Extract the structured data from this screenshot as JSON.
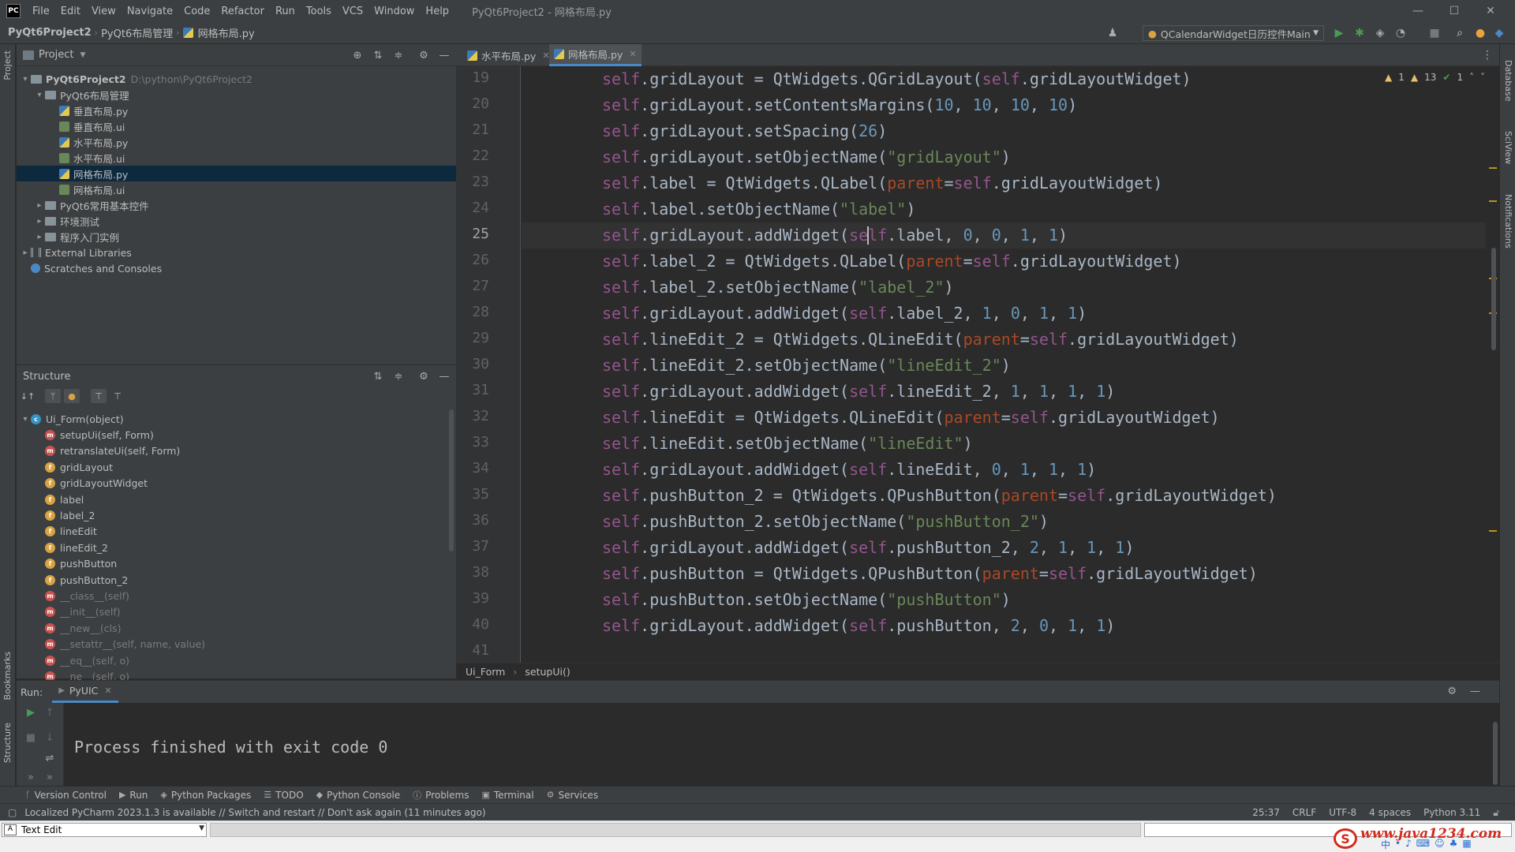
{
  "menubar": {
    "app_logo": "PC",
    "items": [
      "File",
      "Edit",
      "View",
      "Navigate",
      "Code",
      "Refactor",
      "Run",
      "Tools",
      "VCS",
      "Window",
      "Help"
    ],
    "window_title": "PyQt6Project2 - 网格布局.py"
  },
  "navbar": {
    "crumbs": [
      "PyQt6Project2",
      "PyQt6布局管理",
      "网格布局.py"
    ],
    "run_config": "QCalendarWidget日历控件Main"
  },
  "project": {
    "header": "Project",
    "tree": [
      {
        "label": "PyQt6Project2",
        "extra": "D:\\python\\PyQt6Project2",
        "indent": 0,
        "kind": "folder",
        "arrow": "▾",
        "bold": true
      },
      {
        "label": "PyQt6布局管理",
        "indent": 1,
        "kind": "folder",
        "arrow": "▾"
      },
      {
        "label": "垂直布局.py",
        "indent": 2,
        "kind": "py"
      },
      {
        "label": "垂直布局.ui",
        "indent": 2,
        "kind": "ui"
      },
      {
        "label": "水平布局.py",
        "indent": 2,
        "kind": "py"
      },
      {
        "label": "水平布局.ui",
        "indent": 2,
        "kind": "ui"
      },
      {
        "label": "网格布局.py",
        "indent": 2,
        "kind": "py",
        "selected": true
      },
      {
        "label": "网格布局.ui",
        "indent": 2,
        "kind": "ui"
      },
      {
        "label": "PyQt6常用基本控件",
        "indent": 1,
        "kind": "folder",
        "arrow": "▸"
      },
      {
        "label": "环境测试",
        "indent": 1,
        "kind": "folder",
        "arrow": "▸"
      },
      {
        "label": "程序入门实例",
        "indent": 1,
        "kind": "folder",
        "arrow": "▸"
      },
      {
        "label": "External Libraries",
        "indent": 0,
        "kind": "lib",
        "arrow": "▸"
      },
      {
        "label": "Scratches and Consoles",
        "indent": 0,
        "kind": "scratch"
      }
    ]
  },
  "structure": {
    "header": "Structure",
    "items": [
      {
        "label": "Ui_Form(object)",
        "badge": "c",
        "indent": 0,
        "arrow": "▾"
      },
      {
        "label": "setupUi(self, Form)",
        "badge": "m",
        "indent": 1
      },
      {
        "label": "retranslateUi(self, Form)",
        "badge": "m",
        "indent": 1
      },
      {
        "label": "gridLayout",
        "badge": "f",
        "indent": 1
      },
      {
        "label": "gridLayoutWidget",
        "badge": "f",
        "indent": 1
      },
      {
        "label": "label",
        "badge": "f",
        "indent": 1
      },
      {
        "label": "label_2",
        "badge": "f",
        "indent": 1
      },
      {
        "label": "lineEdit",
        "badge": "f",
        "indent": 1
      },
      {
        "label": "lineEdit_2",
        "badge": "f",
        "indent": 1
      },
      {
        "label": "pushButton",
        "badge": "f",
        "indent": 1
      },
      {
        "label": "pushButton_2",
        "badge": "f",
        "indent": 1
      },
      {
        "label": "__class__(self)",
        "badge": "m",
        "indent": 1,
        "grey": true
      },
      {
        "label": "__init__(self)",
        "badge": "m",
        "indent": 1,
        "grey": true
      },
      {
        "label": "__new__(cls)",
        "badge": "m",
        "indent": 1,
        "grey": true
      },
      {
        "label": "__setattr__(self, name, value)",
        "badge": "m",
        "indent": 1,
        "grey": true
      },
      {
        "label": "__eq__(self, o)",
        "badge": "m",
        "indent": 1,
        "grey": true
      },
      {
        "label": "__ne__(self, o)",
        "badge": "m",
        "indent": 1,
        "grey": true
      }
    ]
  },
  "editor": {
    "tabs": [
      {
        "label": "水平布局.py",
        "active": false
      },
      {
        "label": "网格布局.py",
        "active": true
      }
    ],
    "inspections": {
      "warn1": "1",
      "warn2": "13",
      "ok": "1"
    },
    "current_line": 25,
    "lines": [
      {
        "n": 19,
        "code": "self.gridLayout = QtWidgets.QGridLayout(self.gridLayoutWidget)"
      },
      {
        "n": 20,
        "code": "self.gridLayout.setContentsMargins(10, 10, 10, 10)"
      },
      {
        "n": 21,
        "code": "self.gridLayout.setSpacing(26)"
      },
      {
        "n": 22,
        "code": "self.gridLayout.setObjectName(\"gridLayout\")"
      },
      {
        "n": 23,
        "code": "self.label = QtWidgets.QLabel(parent=self.gridLayoutWidget)"
      },
      {
        "n": 24,
        "code": "self.label.setObjectName(\"label\")"
      },
      {
        "n": 25,
        "code": "self.gridLayout.addWidget(self.label, 0, 0, 1, 1)"
      },
      {
        "n": 26,
        "code": "self.label_2 = QtWidgets.QLabel(parent=self.gridLayoutWidget)"
      },
      {
        "n": 27,
        "code": "self.label_2.setObjectName(\"label_2\")"
      },
      {
        "n": 28,
        "code": "self.gridLayout.addWidget(self.label_2, 1, 0, 1, 1)"
      },
      {
        "n": 29,
        "code": "self.lineEdit_2 = QtWidgets.QLineEdit(parent=self.gridLayoutWidget)"
      },
      {
        "n": 30,
        "code": "self.lineEdit_2.setObjectName(\"lineEdit_2\")"
      },
      {
        "n": 31,
        "code": "self.gridLayout.addWidget(self.lineEdit_2, 1, 1, 1, 1)"
      },
      {
        "n": 32,
        "code": "self.lineEdit = QtWidgets.QLineEdit(parent=self.gridLayoutWidget)"
      },
      {
        "n": 33,
        "code": "self.lineEdit.setObjectName(\"lineEdit\")"
      },
      {
        "n": 34,
        "code": "self.gridLayout.addWidget(self.lineEdit, 0, 1, 1, 1)"
      },
      {
        "n": 35,
        "code": "self.pushButton_2 = QtWidgets.QPushButton(parent=self.gridLayoutWidget)"
      },
      {
        "n": 36,
        "code": "self.pushButton_2.setObjectName(\"pushButton_2\")"
      },
      {
        "n": 37,
        "code": "self.gridLayout.addWidget(self.pushButton_2, 2, 1, 1, 1)"
      },
      {
        "n": 38,
        "code": "self.pushButton = QtWidgets.QPushButton(parent=self.gridLayoutWidget)"
      },
      {
        "n": 39,
        "code": "self.pushButton.setObjectName(\"pushButton\")"
      },
      {
        "n": 40,
        "code": "self.gridLayout.addWidget(self.pushButton, 2, 0, 1, 1)"
      },
      {
        "n": 41,
        "code": ""
      }
    ],
    "breadcrumb": [
      "Ui_Form",
      "setupUi()"
    ]
  },
  "run": {
    "label": "Run:",
    "tab": "PyUIC",
    "output": "Process finished with exit code 0"
  },
  "tooltabs": [
    "Version Control",
    "Run",
    "Python Packages",
    "TODO",
    "Python Console",
    "Problems",
    "Terminal",
    "Services"
  ],
  "statusbar": {
    "message": "Localized PyCharm 2023.1.3 is available // Switch and restart // Don't ask again (11 minutes ago)",
    "position": "25:37",
    "line_sep": "CRLF",
    "encoding": "UTF-8",
    "indent": "4 spaces",
    "interpreter": "Python 3.11"
  },
  "sidestrip": {
    "left": [
      "Project",
      "Bookmarks",
      "Structure"
    ],
    "right": [
      "Database",
      "SciView",
      "Notifications"
    ]
  },
  "ime": {
    "mode": "Text Edit"
  },
  "watermark": "www.java1234.com",
  "colors": {
    "self": "#94558d",
    "string": "#6a8759",
    "number": "#6897bb",
    "param": "#aa4926",
    "text": "#a9b7c6",
    "selection": "#0d293e"
  }
}
